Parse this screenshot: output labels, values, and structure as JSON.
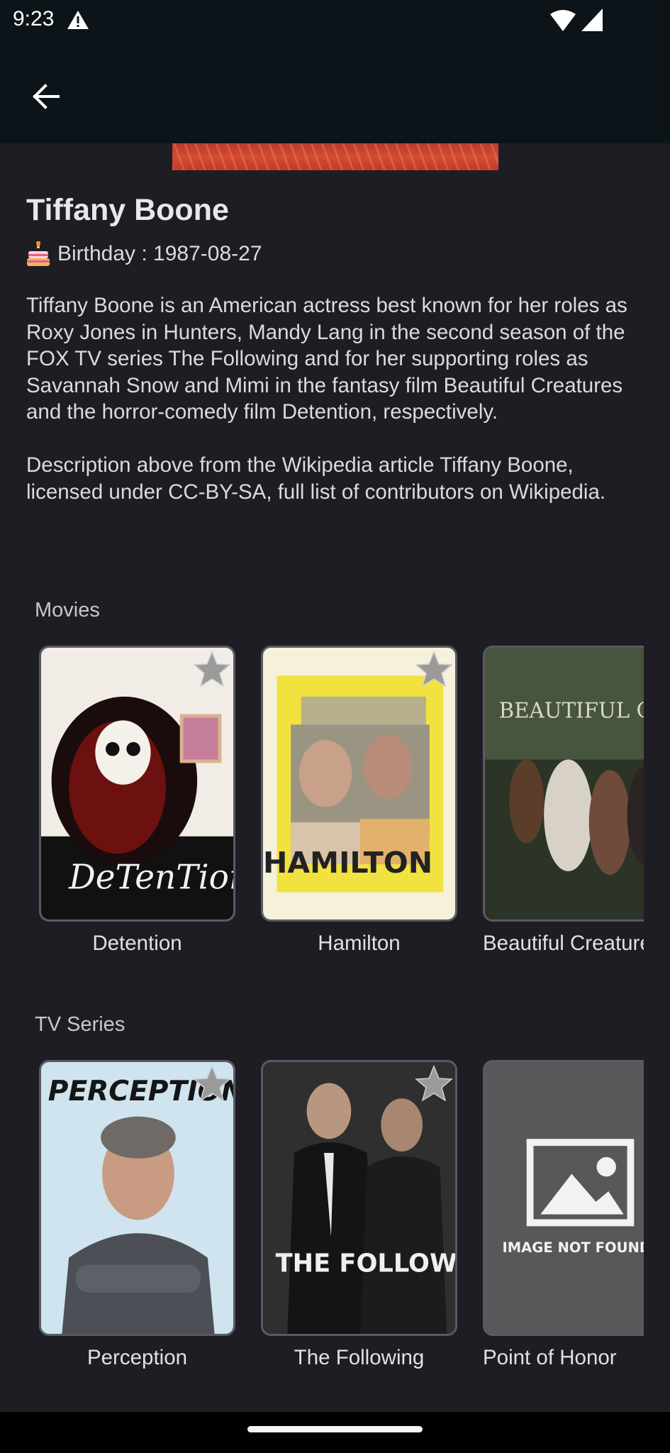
{
  "status_bar": {
    "time": "9:23",
    "icons": [
      "warning-icon",
      "wifi-icon",
      "signal-icon"
    ]
  },
  "app_bar": {
    "back_icon": "arrow-left-icon"
  },
  "person": {
    "name": "Tiffany Boone",
    "birthday": "Birthday : 1987-08-27",
    "birthday_icon": "cake-icon",
    "bio": [
      "Tiffany Boone is an American actress best known for her roles as Roxy Jones in Hunters, Mandy Lang in the second season of the FOX TV series The Following and for her supporting roles as Savannah Snow and Mimi in the fantasy film Beautiful Creatures and the horror-comedy film Detention, respectively.",
      "Description above from the Wikipedia article Tiffany Boone, licensed under CC-BY-SA, full list of contributors on Wikipedia."
    ]
  },
  "movies": {
    "title": "Movies",
    "items": [
      {
        "title": "Detention",
        "poster_text": "DeTenTion"
      },
      {
        "title": "Hamilton",
        "poster_text": "HAMILTON"
      },
      {
        "title": "Beautiful Creatures",
        "poster_text": "BEAUTIFUL CREATURES"
      }
    ]
  },
  "tv_series": {
    "title": "TV Series",
    "items": [
      {
        "title": "Perception",
        "poster_text": "PERCEPTION"
      },
      {
        "title": "The Following",
        "poster_text": "THE FOLLOWING"
      },
      {
        "title": "Point of Honor",
        "poster_text": "IMAGE NOT FOUND"
      }
    ]
  },
  "colors": {
    "background": "#1f1d24",
    "app_bar": "#0c1419",
    "card_border": "#5b5a62"
  }
}
